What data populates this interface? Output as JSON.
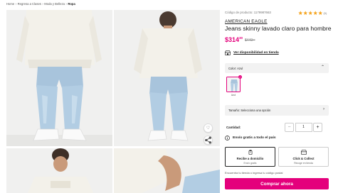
{
  "breadcrumb": [
    "Home",
    "Regresa a Clases",
    "Moda y Belleza",
    "Ropa"
  ],
  "gallery": {
    "favorite_icon": "heart-icon",
    "share_icon": "share-icon"
  },
  "product": {
    "code": "Código de producto: 1179987663",
    "rating": 5,
    "rating_count": "(0)",
    "brand": "AMERICAN EAGLE",
    "title": "Jeans skinny lavado claro para hombre",
    "price_main": "$314",
    "price_cents": "30",
    "old_price_main": "$449",
    "old_price_cents": "00"
  },
  "availability": {
    "icon": "store-icon",
    "label": "Ver disponibilidad en tienda"
  },
  "color": {
    "label": "Color: Azul",
    "selected_swatch": "Azul"
  },
  "size": {
    "label": "Tamaño: Selecciona una opción"
  },
  "quantity": {
    "label": "Cantidad:",
    "minus": "−",
    "plus": "+",
    "value": "1"
  },
  "shipping": {
    "icon": "info-icon",
    "label": "Envío gratis a todo el país"
  },
  "delivery_options": [
    {
      "title": "Recibe a domicilio",
      "subtitle": "Envío gratis",
      "icon": "delivery-icon"
    },
    {
      "title": "Click & Collect",
      "subtitle": "Recoge en tienda",
      "icon": "store-icon"
    }
  ],
  "zip_hint": "Encuentra tu tienda o ingresa tu código postal",
  "buy_button": "Comprar ahora",
  "colors": {
    "accent": "#e4007c",
    "star": "#f5a623"
  }
}
